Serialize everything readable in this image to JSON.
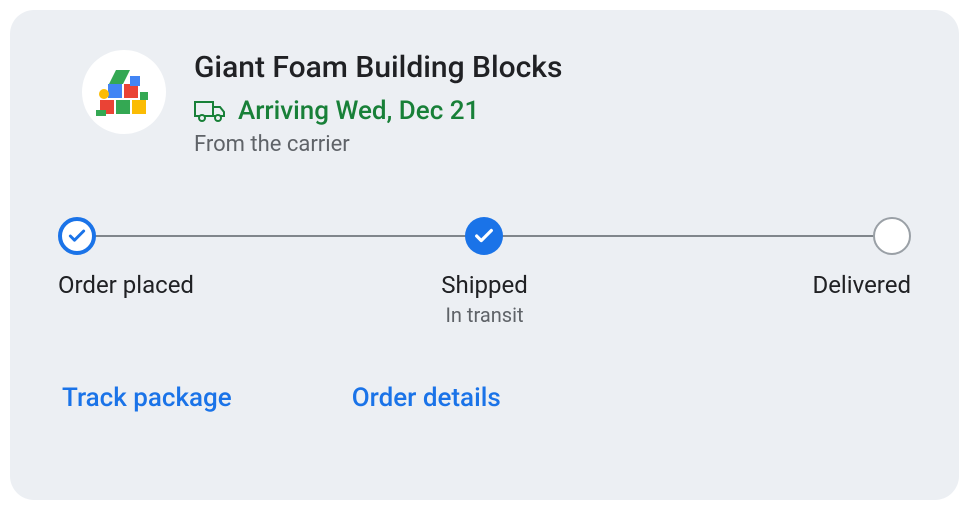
{
  "product": {
    "title": "Giant Foam Building Blocks",
    "arrival": "Arriving Wed, Dec 21",
    "source": "From the carrier"
  },
  "timeline": {
    "steps": [
      {
        "title": "Order placed",
        "sub": "",
        "state": "done"
      },
      {
        "title": "Shipped",
        "sub": "In transit",
        "state": "current"
      },
      {
        "title": "Delivered",
        "sub": "",
        "state": "pending"
      }
    ]
  },
  "actions": {
    "track": "Track package",
    "details": "Order details"
  },
  "colors": {
    "accent_blue": "#1a73e8",
    "accent_green": "#188038",
    "card_bg": "#eceff3",
    "muted": "#5f6368"
  }
}
